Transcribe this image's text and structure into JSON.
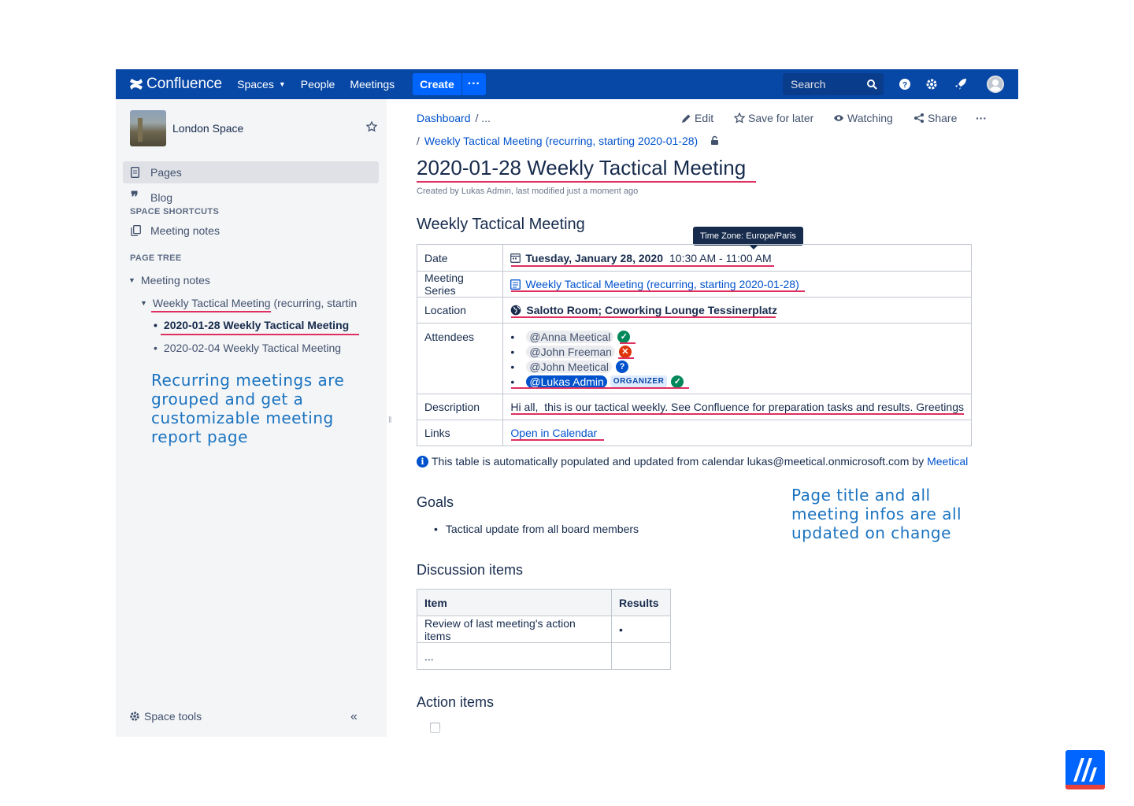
{
  "nav": {
    "product": "Confluence",
    "items": [
      {
        "label": "Spaces"
      },
      {
        "label": "People"
      },
      {
        "label": "Meetings"
      }
    ],
    "create": "Create",
    "more": "···",
    "search_placeholder": "Search"
  },
  "sidebar": {
    "space_name": "London Space",
    "pages": "Pages",
    "blog": "Blog",
    "shortcuts_heading": "SPACE SHORTCUTS",
    "shortcut": "Meeting notes",
    "tree_heading": "PAGE TREE",
    "tree": {
      "root": "Meeting notes",
      "series": "Weekly Tactical Meeting (recurring, startin",
      "current": "2020-01-28 Weekly Tactical Meeting",
      "next": "2020-02-04 Weekly Tactical Meeting"
    },
    "space_tools": "Space tools",
    "collapse": "«"
  },
  "annotations": {
    "left": [
      "Recurring meetings are",
      "grouped and get a",
      "customizable meeting",
      "report page"
    ],
    "right": [
      "Page title and all",
      "meeting infos are all",
      "updated on change"
    ]
  },
  "page": {
    "breadcrumb_root": "Dashboard",
    "breadcrumb_more": "/ ...",
    "parent_slash": "/",
    "parent": "Weekly Tactical Meeting (recurring, starting 2020-01-28)",
    "actions": {
      "edit": "Edit",
      "save": "Save for later",
      "watch": "Watching",
      "share": "Share",
      "more": "···"
    },
    "title": "2020-01-28 Weekly Tactical Meeting",
    "byline": "Created by Lukas Admin, last modified just a moment ago",
    "section_heading": "Weekly Tactical Meeting",
    "tooltip": "Time Zone: Europe/Paris",
    "meta": {
      "date_label": "Date",
      "date_day": "Tuesday, January 28, 2020",
      "date_time": "10:30 AM - 11:00 AM",
      "series_label": "Meeting Series",
      "series_value": "Weekly Tactical Meeting (recurring, starting 2020-01-28)",
      "location_label": "Location",
      "location_value": "Salotto Room; Coworking Lounge Tessinerplatz",
      "attendees_label": "Attendees",
      "attendees": [
        {
          "name": "@Anna Meetical",
          "status": "accepted"
        },
        {
          "name": "@John Freeman",
          "status": "declined"
        },
        {
          "name": "@John Meetical",
          "status": "unknown"
        },
        {
          "name": "@Lukas Admin",
          "status": "accepted",
          "badge": "ORGANIZER"
        }
      ],
      "description_label": "Description",
      "description_value": "Hi all,  this is our tactical weekly. See Confluence for preparation tasks and results. Greetings",
      "links_label": "Links",
      "links_value": "Open in Calendar"
    },
    "info_text": "This table is automatically populated and updated from calendar lukas@meetical.onmicrosoft.com by",
    "info_link": "Meetical",
    "goals_heading": "Goals",
    "goal_item": "Tactical update from all board members",
    "discussion_heading": "Discussion items",
    "discussion": {
      "headers": [
        "Item",
        "Results"
      ],
      "rows": [
        [
          "Review of last meeting's action items",
          "•"
        ],
        [
          "...",
          ""
        ]
      ]
    },
    "action_heading": "Action items"
  },
  "colors": {
    "nav": "#0747a6",
    "create": "#0065ff",
    "underline": "#de2f5f",
    "annotation": "#1a73c0"
  }
}
